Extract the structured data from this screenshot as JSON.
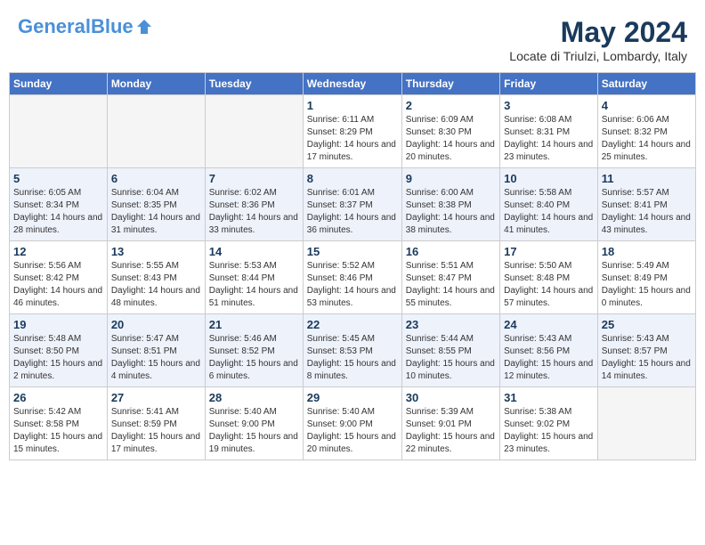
{
  "header": {
    "logo_line1": "General",
    "logo_line2": "Blue",
    "month_title": "May 2024",
    "location": "Locate di Triulzi, Lombardy, Italy"
  },
  "days_of_week": [
    "Sunday",
    "Monday",
    "Tuesday",
    "Wednesday",
    "Thursday",
    "Friday",
    "Saturday"
  ],
  "weeks": [
    [
      {
        "num": "",
        "sunrise": "",
        "sunset": "",
        "daylight": ""
      },
      {
        "num": "",
        "sunrise": "",
        "sunset": "",
        "daylight": ""
      },
      {
        "num": "",
        "sunrise": "",
        "sunset": "",
        "daylight": ""
      },
      {
        "num": "1",
        "sunrise": "Sunrise: 6:11 AM",
        "sunset": "Sunset: 8:29 PM",
        "daylight": "Daylight: 14 hours and 17 minutes."
      },
      {
        "num": "2",
        "sunrise": "Sunrise: 6:09 AM",
        "sunset": "Sunset: 8:30 PM",
        "daylight": "Daylight: 14 hours and 20 minutes."
      },
      {
        "num": "3",
        "sunrise": "Sunrise: 6:08 AM",
        "sunset": "Sunset: 8:31 PM",
        "daylight": "Daylight: 14 hours and 23 minutes."
      },
      {
        "num": "4",
        "sunrise": "Sunrise: 6:06 AM",
        "sunset": "Sunset: 8:32 PM",
        "daylight": "Daylight: 14 hours and 25 minutes."
      }
    ],
    [
      {
        "num": "5",
        "sunrise": "Sunrise: 6:05 AM",
        "sunset": "Sunset: 8:34 PM",
        "daylight": "Daylight: 14 hours and 28 minutes."
      },
      {
        "num": "6",
        "sunrise": "Sunrise: 6:04 AM",
        "sunset": "Sunset: 8:35 PM",
        "daylight": "Daylight: 14 hours and 31 minutes."
      },
      {
        "num": "7",
        "sunrise": "Sunrise: 6:02 AM",
        "sunset": "Sunset: 8:36 PM",
        "daylight": "Daylight: 14 hours and 33 minutes."
      },
      {
        "num": "8",
        "sunrise": "Sunrise: 6:01 AM",
        "sunset": "Sunset: 8:37 PM",
        "daylight": "Daylight: 14 hours and 36 minutes."
      },
      {
        "num": "9",
        "sunrise": "Sunrise: 6:00 AM",
        "sunset": "Sunset: 8:38 PM",
        "daylight": "Daylight: 14 hours and 38 minutes."
      },
      {
        "num": "10",
        "sunrise": "Sunrise: 5:58 AM",
        "sunset": "Sunset: 8:40 PM",
        "daylight": "Daylight: 14 hours and 41 minutes."
      },
      {
        "num": "11",
        "sunrise": "Sunrise: 5:57 AM",
        "sunset": "Sunset: 8:41 PM",
        "daylight": "Daylight: 14 hours and 43 minutes."
      }
    ],
    [
      {
        "num": "12",
        "sunrise": "Sunrise: 5:56 AM",
        "sunset": "Sunset: 8:42 PM",
        "daylight": "Daylight: 14 hours and 46 minutes."
      },
      {
        "num": "13",
        "sunrise": "Sunrise: 5:55 AM",
        "sunset": "Sunset: 8:43 PM",
        "daylight": "Daylight: 14 hours and 48 minutes."
      },
      {
        "num": "14",
        "sunrise": "Sunrise: 5:53 AM",
        "sunset": "Sunset: 8:44 PM",
        "daylight": "Daylight: 14 hours and 51 minutes."
      },
      {
        "num": "15",
        "sunrise": "Sunrise: 5:52 AM",
        "sunset": "Sunset: 8:46 PM",
        "daylight": "Daylight: 14 hours and 53 minutes."
      },
      {
        "num": "16",
        "sunrise": "Sunrise: 5:51 AM",
        "sunset": "Sunset: 8:47 PM",
        "daylight": "Daylight: 14 hours and 55 minutes."
      },
      {
        "num": "17",
        "sunrise": "Sunrise: 5:50 AM",
        "sunset": "Sunset: 8:48 PM",
        "daylight": "Daylight: 14 hours and 57 minutes."
      },
      {
        "num": "18",
        "sunrise": "Sunrise: 5:49 AM",
        "sunset": "Sunset: 8:49 PM",
        "daylight": "Daylight: 15 hours and 0 minutes."
      }
    ],
    [
      {
        "num": "19",
        "sunrise": "Sunrise: 5:48 AM",
        "sunset": "Sunset: 8:50 PM",
        "daylight": "Daylight: 15 hours and 2 minutes."
      },
      {
        "num": "20",
        "sunrise": "Sunrise: 5:47 AM",
        "sunset": "Sunset: 8:51 PM",
        "daylight": "Daylight: 15 hours and 4 minutes."
      },
      {
        "num": "21",
        "sunrise": "Sunrise: 5:46 AM",
        "sunset": "Sunset: 8:52 PM",
        "daylight": "Daylight: 15 hours and 6 minutes."
      },
      {
        "num": "22",
        "sunrise": "Sunrise: 5:45 AM",
        "sunset": "Sunset: 8:53 PM",
        "daylight": "Daylight: 15 hours and 8 minutes."
      },
      {
        "num": "23",
        "sunrise": "Sunrise: 5:44 AM",
        "sunset": "Sunset: 8:55 PM",
        "daylight": "Daylight: 15 hours and 10 minutes."
      },
      {
        "num": "24",
        "sunrise": "Sunrise: 5:43 AM",
        "sunset": "Sunset: 8:56 PM",
        "daylight": "Daylight: 15 hours and 12 minutes."
      },
      {
        "num": "25",
        "sunrise": "Sunrise: 5:43 AM",
        "sunset": "Sunset: 8:57 PM",
        "daylight": "Daylight: 15 hours and 14 minutes."
      }
    ],
    [
      {
        "num": "26",
        "sunrise": "Sunrise: 5:42 AM",
        "sunset": "Sunset: 8:58 PM",
        "daylight": "Daylight: 15 hours and 15 minutes."
      },
      {
        "num": "27",
        "sunrise": "Sunrise: 5:41 AM",
        "sunset": "Sunset: 8:59 PM",
        "daylight": "Daylight: 15 hours and 17 minutes."
      },
      {
        "num": "28",
        "sunrise": "Sunrise: 5:40 AM",
        "sunset": "Sunset: 9:00 PM",
        "daylight": "Daylight: 15 hours and 19 minutes."
      },
      {
        "num": "29",
        "sunrise": "Sunrise: 5:40 AM",
        "sunset": "Sunset: 9:00 PM",
        "daylight": "Daylight: 15 hours and 20 minutes."
      },
      {
        "num": "30",
        "sunrise": "Sunrise: 5:39 AM",
        "sunset": "Sunset: 9:01 PM",
        "daylight": "Daylight: 15 hours and 22 minutes."
      },
      {
        "num": "31",
        "sunrise": "Sunrise: 5:38 AM",
        "sunset": "Sunset: 9:02 PM",
        "daylight": "Daylight: 15 hours and 23 minutes."
      },
      {
        "num": "",
        "sunrise": "",
        "sunset": "",
        "daylight": ""
      }
    ]
  ]
}
